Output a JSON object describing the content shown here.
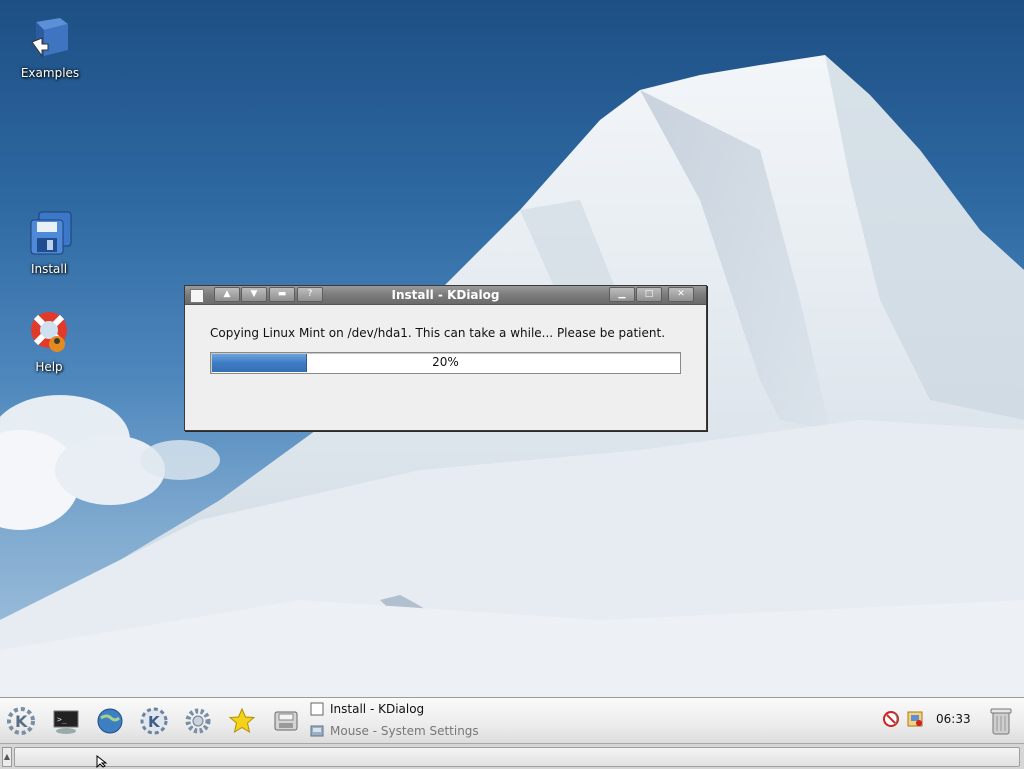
{
  "desktop": {
    "icons": [
      {
        "label": "Examples",
        "icon": "book-shortcut-icon"
      },
      {
        "label": "Install",
        "icon": "floppy-disk-icon"
      },
      {
        "label": "Help",
        "icon": "lifebuoy-icon"
      }
    ]
  },
  "dialog": {
    "title": "Install - KDialog",
    "message": "Copying Linux Mint on /dev/hda1. This can take a while... Please be patient.",
    "progress_value": 0.2,
    "progress_text": "20%"
  },
  "taskbar": {
    "launchers": [
      "kde-menu-icon",
      "terminal-icon",
      "browser-globe-icon",
      "konqueror-icon",
      "settings-gear-icon",
      "favorites-star-icon",
      "floppy-save-icon"
    ],
    "tasks": [
      {
        "label": "Install - KDialog",
        "active": true
      },
      {
        "label": "Mouse - System Settings",
        "active": false
      }
    ],
    "clock": "06:33",
    "tray": [
      "audio-mute-icon",
      "network-card-icon",
      "trash-can-icon"
    ]
  },
  "colors": {
    "progress_fill": "#3d7cc4",
    "titlebar": "#7b7b7b",
    "panel": "#ececec"
  }
}
